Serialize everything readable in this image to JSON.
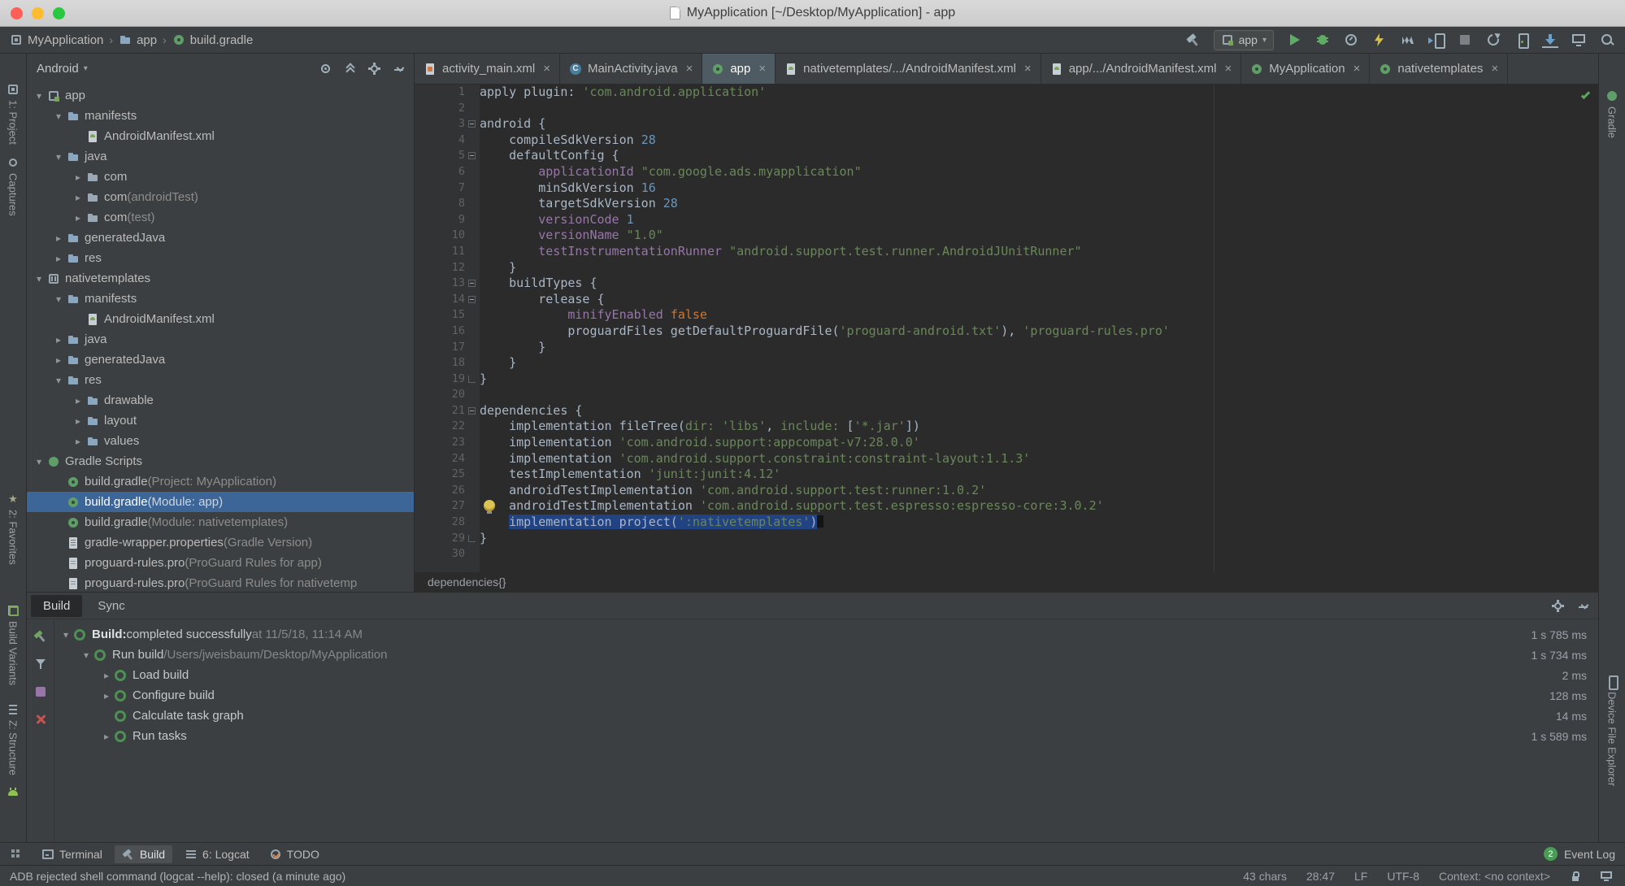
{
  "colors": {
    "panel": "#3c3f41",
    "editor_bg": "#2b2b2b",
    "selection": "#214283",
    "tree_selection": "#3c6598",
    "string": "#6a8759",
    "keyword": "#cc7832",
    "number": "#6897bb",
    "property": "#9876aa",
    "success_green": "#499c54",
    "run_green": "#5fad65",
    "error_red": "#c75450"
  },
  "window": {
    "title": "MyApplication [~/Desktop/MyApplication] - app"
  },
  "toolbar": {
    "breadcrumbs": [
      {
        "label": "MyApplication",
        "icon": "project"
      },
      {
        "label": "app",
        "icon": "folder"
      },
      {
        "label": "build.gradle",
        "icon": "gradle-file"
      }
    ],
    "run_config": "app",
    "action_icons_a": [
      "build-hammer"
    ],
    "action_icons_b": [
      "run",
      "debug",
      "profile",
      "instant-run",
      "profiler",
      "attach-debugger",
      "stop"
    ],
    "action_icons_c": [
      "sync-gradle",
      "avd-manager",
      "sdk-manager",
      "layout-inspector",
      "search"
    ]
  },
  "left_stripe": [
    {
      "label": "1: Project",
      "icon": "project-tool"
    },
    {
      "label": "Captures",
      "icon": "captures"
    },
    {
      "label": "2: Favorites",
      "icon": "favorites"
    },
    {
      "label": "Build Variants",
      "icon": "build-variants"
    },
    {
      "label": "Z: Structure",
      "icon": "structure"
    },
    {
      "label": "",
      "icon": "android"
    }
  ],
  "right_stripe": [
    {
      "label": "Gradle",
      "icon": "gradle"
    },
    {
      "label": "Device File Explorer",
      "icon": "device-explorer"
    }
  ],
  "project_panel": {
    "selector": "Android",
    "header_icons": [
      "locate",
      "collapse-all",
      "gear",
      "hide"
    ],
    "tree": [
      {
        "depth": 0,
        "chev": "o",
        "icon": "module",
        "label": "app"
      },
      {
        "depth": 1,
        "chev": "o",
        "icon": "folder",
        "label": "manifests"
      },
      {
        "depth": 2,
        "chev": "",
        "icon": "manifest",
        "label": "AndroidManifest.xml"
      },
      {
        "depth": 1,
        "chev": "o",
        "icon": "folder",
        "label": "java"
      },
      {
        "depth": 2,
        "chev": "c",
        "icon": "package",
        "label": "com"
      },
      {
        "depth": 2,
        "chev": "c",
        "icon": "package",
        "label": "com",
        "suffix": "(androidTest)"
      },
      {
        "depth": 2,
        "chev": "c",
        "icon": "package",
        "label": "com",
        "suffix": "(test)"
      },
      {
        "depth": 1,
        "chev": "c",
        "icon": "folder",
        "label": "generatedJava"
      },
      {
        "depth": 1,
        "chev": "c",
        "icon": "folder",
        "label": "res"
      },
      {
        "depth": 0,
        "chev": "o",
        "icon": "lib-module",
        "label": "nativetemplates"
      },
      {
        "depth": 1,
        "chev": "o",
        "icon": "folder",
        "label": "manifests"
      },
      {
        "depth": 2,
        "chev": "",
        "icon": "manifest",
        "label": "AndroidManifest.xml"
      },
      {
        "depth": 1,
        "chev": "c",
        "icon": "folder",
        "label": "java"
      },
      {
        "depth": 1,
        "chev": "c",
        "icon": "folder",
        "label": "generatedJava"
      },
      {
        "depth": 1,
        "chev": "o",
        "icon": "folder",
        "label": "res"
      },
      {
        "depth": 2,
        "chev": "c",
        "icon": "folder",
        "label": "drawable"
      },
      {
        "depth": 2,
        "chev": "c",
        "icon": "folder",
        "label": "layout"
      },
      {
        "depth": 2,
        "chev": "c",
        "icon": "folder",
        "label": "values"
      },
      {
        "depth": 0,
        "chev": "o",
        "icon": "gradle",
        "label": "Gradle Scripts"
      },
      {
        "depth": 1,
        "chev": "",
        "icon": "gradle-file",
        "label": "build.gradle",
        "suffix": "(Project: MyApplication)"
      },
      {
        "depth": 1,
        "chev": "",
        "icon": "gradle-file",
        "label": "build.gradle",
        "suffix": "(Module: app)",
        "sel": true
      },
      {
        "depth": 1,
        "chev": "",
        "icon": "gradle-file",
        "label": "build.gradle",
        "suffix": "(Module: nativetemplates)"
      },
      {
        "depth": 1,
        "chev": "",
        "icon": "properties",
        "label": "gradle-wrapper.properties",
        "suffix": "(Gradle Version)"
      },
      {
        "depth": 1,
        "chev": "",
        "icon": "text-file",
        "label": "proguard-rules.pro",
        "suffix": "(ProGuard Rules for app)"
      },
      {
        "depth": 1,
        "chev": "",
        "icon": "text-file",
        "label": "proguard-rules.pro",
        "suffix": "(ProGuard Rules for nativetemp"
      }
    ]
  },
  "editor": {
    "tabs": [
      {
        "label": "activity_main.xml",
        "icon": "layout-file"
      },
      {
        "label": "MainActivity.java",
        "icon": "java-class"
      },
      {
        "label": "app",
        "icon": "gradle-file",
        "selected": true
      },
      {
        "label": "nativetemplates/.../AndroidManifest.xml",
        "icon": "manifest"
      },
      {
        "label": "app/.../AndroidManifest.xml",
        "icon": "manifest"
      },
      {
        "label": "MyApplication",
        "icon": "gradle-file"
      },
      {
        "label": "nativetemplates",
        "icon": "gradle-file"
      }
    ],
    "breadcrumb": "dependencies{}",
    "code": {
      "lines": [
        {
          "n": 1,
          "segs": [
            [
              "apply plugin: ",
              "p"
            ],
            [
              "'com.android.application'",
              "s"
            ]
          ]
        },
        {
          "n": 2,
          "segs": []
        },
        {
          "n": 3,
          "fold": "open",
          "segs": [
            [
              "android {",
              "p"
            ]
          ]
        },
        {
          "n": 4,
          "segs": [
            [
              "    compileSdkVersion ",
              "p"
            ],
            [
              "28",
              "n"
            ]
          ]
        },
        {
          "n": 5,
          "fold": "open",
          "segs": [
            [
              "    defaultConfig {",
              "p"
            ]
          ]
        },
        {
          "n": 6,
          "segs": [
            [
              "        ",
              "p"
            ],
            [
              "applicationId",
              "f"
            ],
            [
              " ",
              "p"
            ],
            [
              "\"com.google.ads.myapplication\"",
              "s"
            ]
          ]
        },
        {
          "n": 7,
          "segs": [
            [
              "        minSdkVersion ",
              "p"
            ],
            [
              "16",
              "n"
            ]
          ]
        },
        {
          "n": 8,
          "segs": [
            [
              "        targetSdkVersion ",
              "p"
            ],
            [
              "28",
              "n"
            ]
          ]
        },
        {
          "n": 9,
          "segs": [
            [
              "        ",
              "p"
            ],
            [
              "versionCode",
              "f"
            ],
            [
              " ",
              "p"
            ],
            [
              "1",
              "n"
            ]
          ]
        },
        {
          "n": 10,
          "segs": [
            [
              "        ",
              "p"
            ],
            [
              "versionName",
              "f"
            ],
            [
              " ",
              "p"
            ],
            [
              "\"1.0\"",
              "s"
            ]
          ]
        },
        {
          "n": 11,
          "segs": [
            [
              "        ",
              "p"
            ],
            [
              "testInstrumentationRunner",
              "f"
            ],
            [
              " ",
              "p"
            ],
            [
              "\"android.support.test.runner.AndroidJUnitRunner\"",
              "s"
            ]
          ]
        },
        {
          "n": 12,
          "segs": [
            [
              "    }",
              "p"
            ]
          ]
        },
        {
          "n": 13,
          "fold": "open",
          "segs": [
            [
              "    buildTypes {",
              "p"
            ]
          ]
        },
        {
          "n": 14,
          "fold": "open",
          "segs": [
            [
              "        release {",
              "p"
            ]
          ]
        },
        {
          "n": 15,
          "segs": [
            [
              "            ",
              "p"
            ],
            [
              "minifyEnabled",
              "f"
            ],
            [
              " ",
              "p"
            ],
            [
              "false",
              "k"
            ]
          ]
        },
        {
          "n": 16,
          "segs": [
            [
              "            proguardFiles getDefaultProguardFile(",
              "p"
            ],
            [
              "'proguard-android.txt'",
              "s"
            ],
            [
              "), ",
              "p"
            ],
            [
              "'proguard-rules.pro'",
              "s"
            ]
          ]
        },
        {
          "n": 17,
          "segs": [
            [
              "        }",
              "p"
            ]
          ]
        },
        {
          "n": 18,
          "segs": [
            [
              "    }",
              "p"
            ]
          ]
        },
        {
          "n": 19,
          "fold": "close",
          "segs": [
            [
              "}",
              "p"
            ]
          ]
        },
        {
          "n": 20,
          "segs": []
        },
        {
          "n": 21,
          "fold": "open",
          "segs": [
            [
              "dependencies {",
              "p"
            ]
          ]
        },
        {
          "n": 22,
          "segs": [
            [
              "    implementation fileTree(",
              "p"
            ],
            [
              "dir:",
              "na"
            ],
            [
              " ",
              "p"
            ],
            [
              "'libs'",
              "s"
            ],
            [
              ", ",
              "p"
            ],
            [
              "include:",
              "na"
            ],
            [
              " [",
              "p"
            ],
            [
              "'*.jar'",
              "s"
            ],
            [
              "])",
              "p"
            ]
          ]
        },
        {
          "n": 23,
          "segs": [
            [
              "    implementation ",
              "p"
            ],
            [
              "'com.android.support:appcompat-v7:28.0.0'",
              "s"
            ]
          ]
        },
        {
          "n": 24,
          "segs": [
            [
              "    implementation ",
              "p"
            ],
            [
              "'com.android.support.constraint:constraint-layout:1.1.3'",
              "s"
            ]
          ]
        },
        {
          "n": 25,
          "segs": [
            [
              "    testImplementation ",
              "p"
            ],
            [
              "'junit:junit:4.12'",
              "s"
            ]
          ]
        },
        {
          "n": 26,
          "segs": [
            [
              "    androidTestImplementation ",
              "p"
            ],
            [
              "'com.android.support.test:runner:1.0.2'",
              "s"
            ]
          ]
        },
        {
          "n": 27,
          "bulb": true,
          "segs": [
            [
              "    androidTestImplementation ",
              "p"
            ],
            [
              "'com.android.support.test.espresso:espresso-core:3.0.2'",
              "s"
            ]
          ]
        },
        {
          "n": 28,
          "caret": true,
          "segs": [
            [
              "    ",
              "p"
            ],
            [
              "implementation project(",
              "p sel"
            ],
            [
              "':nativetemplates'",
              "s sel"
            ],
            [
              ")",
              "p sel"
            ]
          ]
        },
        {
          "n": 29,
          "fold": "close",
          "segs": [
            [
              "}",
              "p"
            ]
          ]
        },
        {
          "n": 30,
          "segs": []
        }
      ]
    }
  },
  "build_panel": {
    "tabs": [
      {
        "label": "Build",
        "selected": true
      },
      {
        "label": "Sync",
        "selected": false
      }
    ],
    "header_icons": [
      "gear",
      "hide"
    ],
    "toolbar": [
      "rerun-build",
      "filter",
      "options",
      "close"
    ],
    "rows": [
      {
        "depth": 0,
        "chev": "o",
        "segs": [
          [
            "Build:",
            "bb"
          ],
          [
            " completed successfully",
            "bt"
          ],
          [
            "  at 11/5/18, 11:14 AM",
            "bd"
          ]
        ],
        "time": "1 s 785 ms"
      },
      {
        "depth": 1,
        "chev": "o",
        "segs": [
          [
            "Run build",
            "bt"
          ],
          [
            "  /Users/jweisbaum/Desktop/MyApplication",
            "bd"
          ]
        ],
        "time": "1 s 734 ms"
      },
      {
        "depth": 2,
        "chev": "c",
        "segs": [
          [
            "Load build",
            "bt"
          ]
        ],
        "time": "2 ms"
      },
      {
        "depth": 2,
        "chev": "c",
        "segs": [
          [
            "Configure build",
            "bt"
          ]
        ],
        "time": "128 ms"
      },
      {
        "depth": 2,
        "chev": "",
        "segs": [
          [
            "Calculate task graph",
            "bt"
          ]
        ],
        "time": "14 ms"
      },
      {
        "depth": 2,
        "chev": "c",
        "segs": [
          [
            "Run tasks",
            "bt"
          ]
        ],
        "time": "1 s 589 ms"
      }
    ]
  },
  "bottom_bar": {
    "tools": [
      {
        "label": "Terminal",
        "icon": "terminal"
      },
      {
        "label": "Build",
        "icon": "hammer",
        "selected": true
      },
      {
        "label": "6: Logcat",
        "icon": "logcat"
      },
      {
        "label": "TODO",
        "icon": "todo"
      }
    ],
    "event_log": {
      "badge": "2",
      "label": "Event Log"
    }
  },
  "status_bar": {
    "message": "ADB rejected shell command (logcat --help): closed (a minute ago)",
    "right": [
      "43 chars",
      "28:47",
      "LF",
      "UTF-8",
      "Context: <no context>"
    ]
  }
}
